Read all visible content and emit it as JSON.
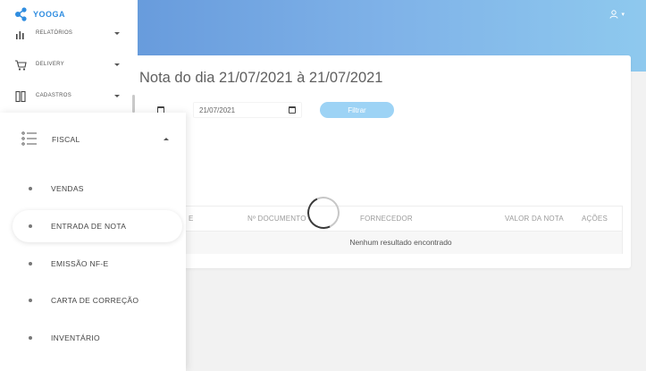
{
  "header": {
    "user_caret": "▾"
  },
  "sidebar": {
    "logo_text": "YOOGA",
    "items": [
      {
        "label": "RELATÓRIOS",
        "icon": "bar-chart-icon"
      },
      {
        "label": "DELIVERY",
        "icon": "cart-icon"
      },
      {
        "label": "CADASTROS",
        "icon": "book-icon"
      }
    ]
  },
  "submenu": {
    "title": "FISCAL",
    "items": [
      {
        "label": "VENDAS",
        "active": false
      },
      {
        "label": "ENTRADA DE NOTA",
        "active": true
      },
      {
        "label": "EMISSÃO NF-E",
        "active": false
      },
      {
        "label": "CARTA DE CORREÇÃO",
        "active": false
      },
      {
        "label": "INVENTÁRIO",
        "active": false
      }
    ]
  },
  "main": {
    "title": "Nota do dia 21/07/2021 à 21/07/2021",
    "date_end": "21/07/2021",
    "filter_button": "Filtrar",
    "table": {
      "columns": [
        "E",
        "Nº DOCUMENTO",
        "FORNECEDOR",
        "VALOR DA NOTA",
        "AÇÕES"
      ],
      "empty_message": "Nenhum resultado encontrado"
    }
  },
  "colors": {
    "accent": "#2f8de0",
    "filter_button": "#9dd3f5"
  }
}
